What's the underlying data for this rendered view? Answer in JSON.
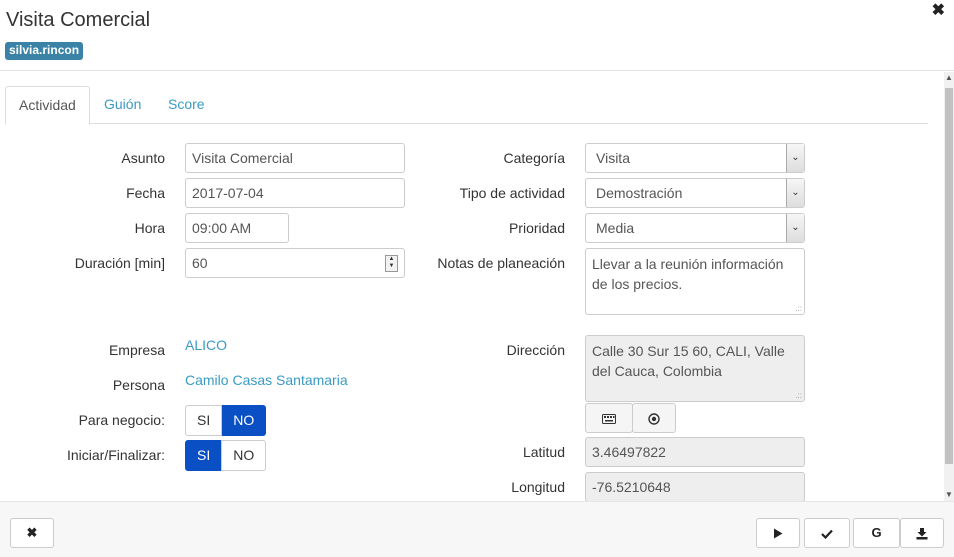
{
  "header": {
    "title": "Visita Comercial",
    "user_badge": "silvia.rincon",
    "close_glyph": "✖"
  },
  "tabs": [
    {
      "label": "Actividad",
      "active": true
    },
    {
      "label": "Guión",
      "active": false
    },
    {
      "label": "Score",
      "active": false
    }
  ],
  "form": {
    "asunto": {
      "label": "Asunto",
      "value": "Visita Comercial"
    },
    "fecha": {
      "label": "Fecha",
      "value": "2017-07-04"
    },
    "hora": {
      "label": "Hora",
      "value": "09:00 AM"
    },
    "duracion": {
      "label": "Duración [min]",
      "value": "60"
    },
    "categoria": {
      "label": "Categoría",
      "value": "Visita"
    },
    "tipo": {
      "label": "Tipo de actividad",
      "value": "Demostración"
    },
    "prioridad": {
      "label": "Prioridad",
      "value": "Media"
    },
    "notas": {
      "label": "Notas de planeación",
      "line1": "Llevar a la reunión información",
      "line2": "de los precios."
    },
    "empresa": {
      "label": "Empresa",
      "value": "ALICO"
    },
    "persona": {
      "label": "Persona",
      "value": "Camilo Casas Santamaria"
    },
    "direccion": {
      "label": "Dirección",
      "line1": "Calle 30 Sur 15 60, CALI, Valle",
      "line2": "del Cauca, Colombia"
    },
    "para_negocio": {
      "label": "Para negocio:",
      "yes": "SI",
      "no": "NO",
      "selected": "NO"
    },
    "iniciar": {
      "label": "Iniciar/Finalizar:",
      "yes": "SI",
      "no": "NO",
      "selected": "SI"
    },
    "latitud": {
      "label": "Latitud",
      "value": "3.46497822"
    },
    "longitud": {
      "label": "Longitud",
      "value": "-76.5210648"
    }
  },
  "icons": {
    "keyboard": "keyboard-icon",
    "locate": "locate-icon",
    "play": "play-icon",
    "check": "check-icon",
    "google": "google-icon",
    "download": "download-icon",
    "close": "close-icon"
  },
  "footer": {
    "g_label": "G"
  },
  "colors": {
    "accent_link": "#3a9bc4",
    "toggle_on": "#0a4fc4",
    "badge": "#3a83a6"
  }
}
